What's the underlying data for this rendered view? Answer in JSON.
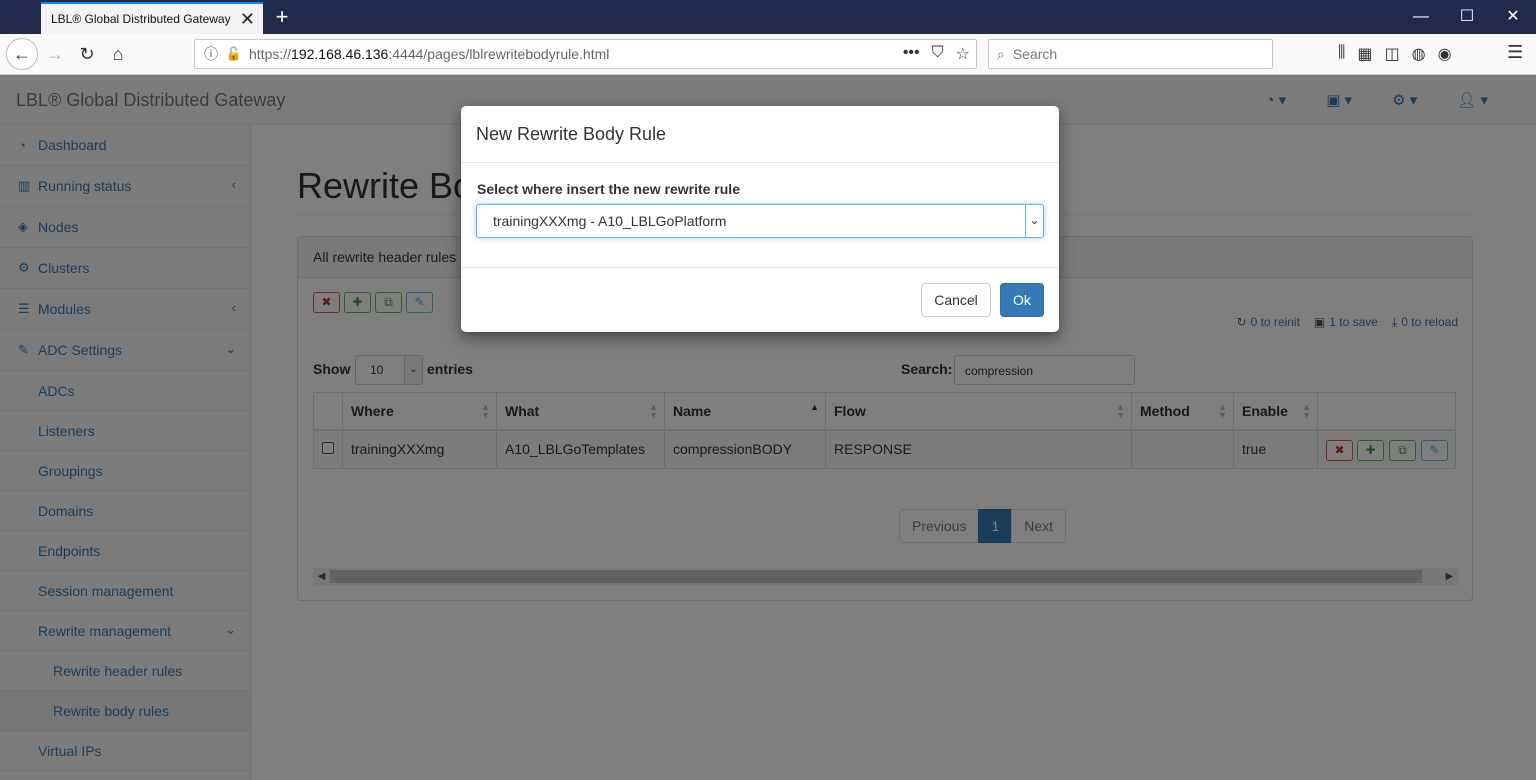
{
  "browser": {
    "tab_title": "LBL® Global Distributed Gateway",
    "url_prefix": "https://",
    "url_host": "192.168.46.136",
    "url_rest": ":4444/pages/lblrewritebodyrule.html",
    "search_placeholder": "Search"
  },
  "app": {
    "brand": "LBL® Global Distributed Gateway"
  },
  "sidebar": {
    "items": [
      {
        "label": "Dashboard",
        "icon": "dashboard-icon"
      },
      {
        "label": "Running status",
        "icon": "bar-chart-icon"
      },
      {
        "label": "Nodes",
        "icon": "cube-icon"
      },
      {
        "label": "Clusters",
        "icon": "cogs-icon"
      },
      {
        "label": "Modules",
        "icon": "list-icon"
      },
      {
        "label": "ADC Settings",
        "icon": "edit-icon"
      },
      {
        "label": "ADCs"
      },
      {
        "label": "Listeners"
      },
      {
        "label": "Groupings"
      },
      {
        "label": "Domains"
      },
      {
        "label": "Endpoints"
      },
      {
        "label": "Session management"
      },
      {
        "label": "Rewrite management"
      },
      {
        "label": "Rewrite header rules"
      },
      {
        "label": "Rewrite body rules"
      },
      {
        "label": "Virtual IPs"
      }
    ]
  },
  "main": {
    "title": "Rewrite Bo",
    "panel_heading": "All rewrite header rules",
    "counters": {
      "reinit": "0 to reinit",
      "save": "1 to save",
      "reload": "0 to reload"
    },
    "show_label": "Show",
    "entries_value": "10",
    "entries_label": "entries",
    "search_label": "Search:",
    "search_value": "compression",
    "columns": [
      "Where",
      "What",
      "Name",
      "Flow",
      "Method",
      "Enable"
    ],
    "rows": [
      {
        "where": "trainingXXXmg",
        "what": "A10_LBLGoTemplates",
        "name": "compressionBODY",
        "flow": "RESPONSE",
        "method": "",
        "enable": "true"
      }
    ],
    "pagination": {
      "previous": "Previous",
      "current": "1",
      "next": "Next"
    }
  },
  "modal": {
    "title": "New Rewrite Body Rule",
    "select_label": "Select where insert the new rewrite rule",
    "select_value": "trainingXXXmg - A10_LBLGoPlatform",
    "cancel": "Cancel",
    "ok": "Ok"
  }
}
